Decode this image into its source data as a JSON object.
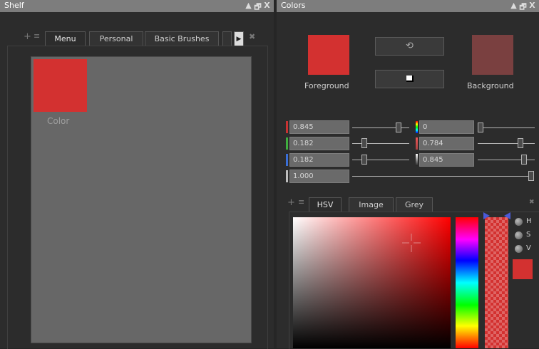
{
  "shelf": {
    "title": "Shelf",
    "controls": [
      "▲",
      "🗗",
      "X"
    ],
    "tabs": [
      "Menu",
      "Personal",
      "Basic Brushes"
    ],
    "active_tab": "Menu",
    "swatch": {
      "label": "Color",
      "color": "#d33130"
    }
  },
  "colors": {
    "title": "Colors",
    "controls": [
      "▲",
      "🗗",
      "X"
    ],
    "foreground": {
      "label": "Foreground",
      "color": "#d33130"
    },
    "background": {
      "label": "Background",
      "color": "#7a4040"
    },
    "sliders_left": [
      {
        "value": "0.845",
        "chip": "#c83232",
        "level": 0.845
      },
      {
        "value": "0.182",
        "chip": "#3fae3f",
        "level": 0.182
      },
      {
        "value": "0.182",
        "chip": "#3a6fd8",
        "level": 0.182
      },
      {
        "value": "1.000",
        "chip": "#bdbdbd",
        "level": 1.0
      }
    ],
    "sliders_right": [
      {
        "value": "0",
        "level": 0.0
      },
      {
        "value": "0.784",
        "level": 0.784
      },
      {
        "value": "0.845",
        "level": 0.845
      }
    ],
    "tabs": [
      "HSV",
      "Image",
      "Grey"
    ],
    "active_tab": "HSV",
    "channels": [
      "H",
      "S",
      "V"
    ],
    "accent": "#d33130"
  }
}
